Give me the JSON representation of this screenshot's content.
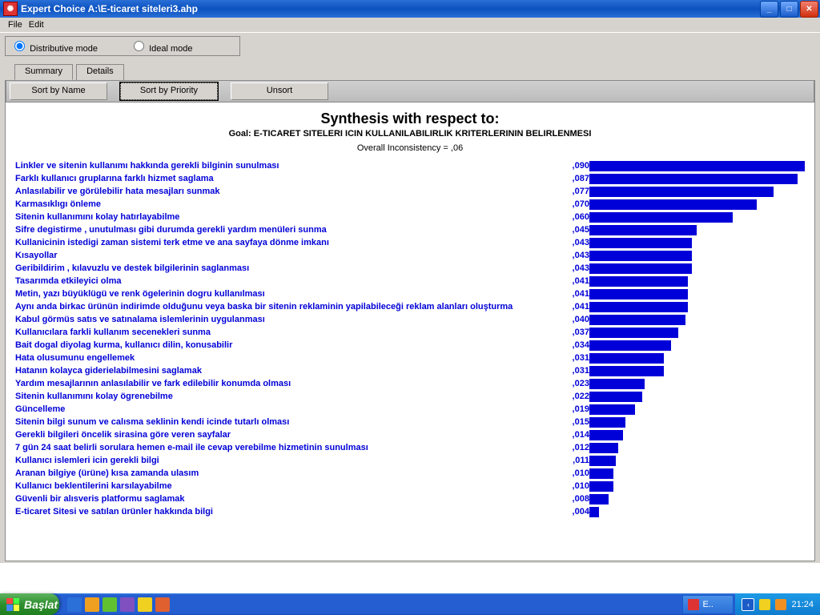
{
  "title": "Expert Choice    A:\\E-ticaret siteleri3.ahp",
  "menu": {
    "file": "File",
    "edit": "Edit"
  },
  "mode": {
    "dist": "Distributive mode",
    "ideal": "Ideal mode"
  },
  "tabs": {
    "summary": "Summary",
    "details": "Details"
  },
  "buttons": {
    "sortname": "Sort by Name",
    "sortprio": "Sort by Priority",
    "unsort": "Unsort"
  },
  "heading": "Synthesis with respect to:",
  "goal": "Goal: E-TICARET SITELERI ICIN KULLANILABILIRLIK KRITERLERININ BELIRLENMESI",
  "inconsistency": "Overall Inconsistency = ,06",
  "chart_data": {
    "type": "bar",
    "orientation": "horizontal",
    "xlabel": "",
    "ylabel": "",
    "max": 0.09,
    "items": [
      {
        "label": "Linkler ve sitenin kullanımı hakkında gerekli bilginin sunulması",
        "value": ",090",
        "num": 0.09
      },
      {
        "label": "Farklı kullanıcı gruplarına farklı hizmet saglama",
        "value": ",087",
        "num": 0.087
      },
      {
        "label": "Anlasılabilir ve görülebilir hata mesajları sunmak",
        "value": ",077",
        "num": 0.077
      },
      {
        "label": "Karmasıklıgı önleme",
        "value": ",070",
        "num": 0.07
      },
      {
        "label": "Sitenin kullanımını kolay hatırlayabilme",
        "value": ",060",
        "num": 0.06
      },
      {
        "label": "Sifre degistirme , unutulması gibi durumda gerekli yardım menüleri sunma",
        "value": ",045",
        "num": 0.045
      },
      {
        "label": "Kullanicinin istedigi zaman sistemi terk etme ve ana sayfaya dönme imkanı",
        "value": ",043",
        "num": 0.043
      },
      {
        "label": "Kısayollar",
        "value": ",043",
        "num": 0.043
      },
      {
        "label": "Geribildirim , kılavuzlu ve destek bilgilerinin saglanması",
        "value": ",043",
        "num": 0.043
      },
      {
        "label": "Tasarımda etkileyici olma",
        "value": ",041",
        "num": 0.041
      },
      {
        "label": "Metin, yazı büyüklügü ve renk ögelerinin dogru kullanılması",
        "value": ",041",
        "num": 0.041
      },
      {
        "label": "Aynı anda birkac ürünün indirimde olduğunu veya baska bir sitenin reklaminin yapilabileceği reklam alanları oluşturma",
        "value": ",041",
        "num": 0.041
      },
      {
        "label": "Kabul görmüs satıs ve satınalama islemlerinin uygulanması",
        "value": ",040",
        "num": 0.04
      },
      {
        "label": "Kullanıcılara farkli kullanım secenekleri sunma",
        "value": ",037",
        "num": 0.037
      },
      {
        "label": "Bait dogal diyolag kurma, kullanıcı dilin, konusabilir",
        "value": ",034",
        "num": 0.034
      },
      {
        "label": "Hata olusumunu engellemek",
        "value": ",031",
        "num": 0.031
      },
      {
        "label": "Hatanın kolayca giderielabilmesini saglamak",
        "value": ",031",
        "num": 0.031
      },
      {
        "label": "Yardım mesajlarının anlasılabilir ve fark edilebilir konumda olması",
        "value": ",023",
        "num": 0.023
      },
      {
        "label": "Sitenin kullanımını kolay ögrenebilme",
        "value": ",022",
        "num": 0.022
      },
      {
        "label": "Güncelleme",
        "value": ",019",
        "num": 0.019
      },
      {
        "label": "Sitenin bilgi sunum ve calısma seklinin kendi icinde tutarlı olması",
        "value": ",015",
        "num": 0.015
      },
      {
        "label": "Gerekli bilgileri öncelik sirasina göre veren sayfalar",
        "value": ",014",
        "num": 0.014
      },
      {
        "label": "7 gün 24 saat belirli sorulara hemen e-mail  ile cevap verebilme hizmetinin sunulması",
        "value": ",012",
        "num": 0.012
      },
      {
        "label": "Kullanıcı islemleri icin gerekli bilgi",
        "value": ",011",
        "num": 0.011
      },
      {
        "label": "Aranan bilgiye (ürüne) kısa zamanda ulasım",
        "value": ",010",
        "num": 0.01
      },
      {
        "label": "Kullanıcı beklentilerini karsılayabilme",
        "value": ",010",
        "num": 0.01
      },
      {
        "label": "Güvenli bir alısveris platformu saglamak",
        "value": ",008",
        "num": 0.008
      },
      {
        "label": "E-ticaret Sitesi ve  satılan ürünler hakkında bilgi",
        "value": ",004",
        "num": 0.004
      }
    ]
  },
  "taskbar": {
    "start": "Başlat",
    "app": "E..",
    "clock": "21:24"
  }
}
